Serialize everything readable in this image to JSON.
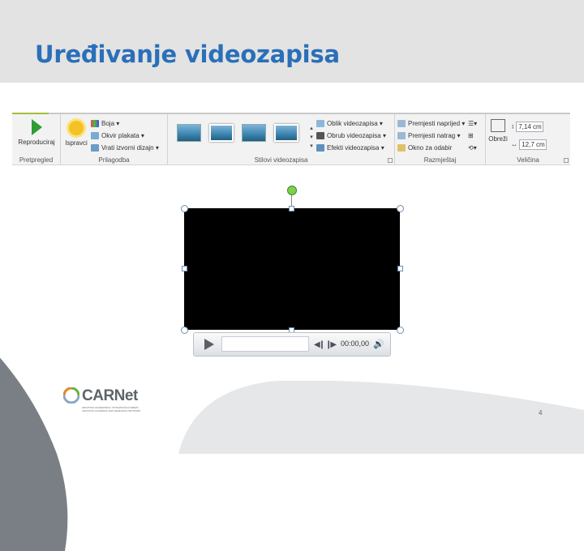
{
  "slide": {
    "title": "Uređivanje videozapisa",
    "page_number": "4"
  },
  "ribbon": {
    "groups": {
      "preview": {
        "label": "Pretpregled",
        "play_label": "Reproduciraj"
      },
      "adjust": {
        "label": "Prilagodba",
        "corrections_label": "Ispravci",
        "color_label": "Boja",
        "poster_label": "Okvir plakata",
        "reset_label": "Vrati izvorni dizajn"
      },
      "styles": {
        "label": "Stilovi videozapisa",
        "shape_label": "Oblik videozapisa",
        "border_label": "Obrub videozapisa",
        "effects_label": "Efekti videozapisa"
      },
      "arrange": {
        "label": "Razmještaj",
        "bring_forward_label": "Premjesti naprijed",
        "send_backward_label": "Premjesti natrag",
        "pane_label": "Okno za odabir"
      },
      "size": {
        "label": "Veličina",
        "crop_label": "Obreži",
        "height_value": "7,14 cm",
        "width_value": "12,7 cm"
      }
    }
  },
  "player": {
    "time": "00:00,00"
  },
  "logo": {
    "name": "CARNet",
    "subtitle_line1": "HRVATSKA AKADEMSKA I ISTRAŽIVAČKA MREŽA",
    "subtitle_line2": "CROATIAN ACADEMIC AND RESEARCH NETWORK"
  },
  "colors": {
    "title": "#2a6fb9",
    "header_bg": "#e3e3e3",
    "video": "#000000",
    "rotate_handle": "#7ed04b"
  }
}
